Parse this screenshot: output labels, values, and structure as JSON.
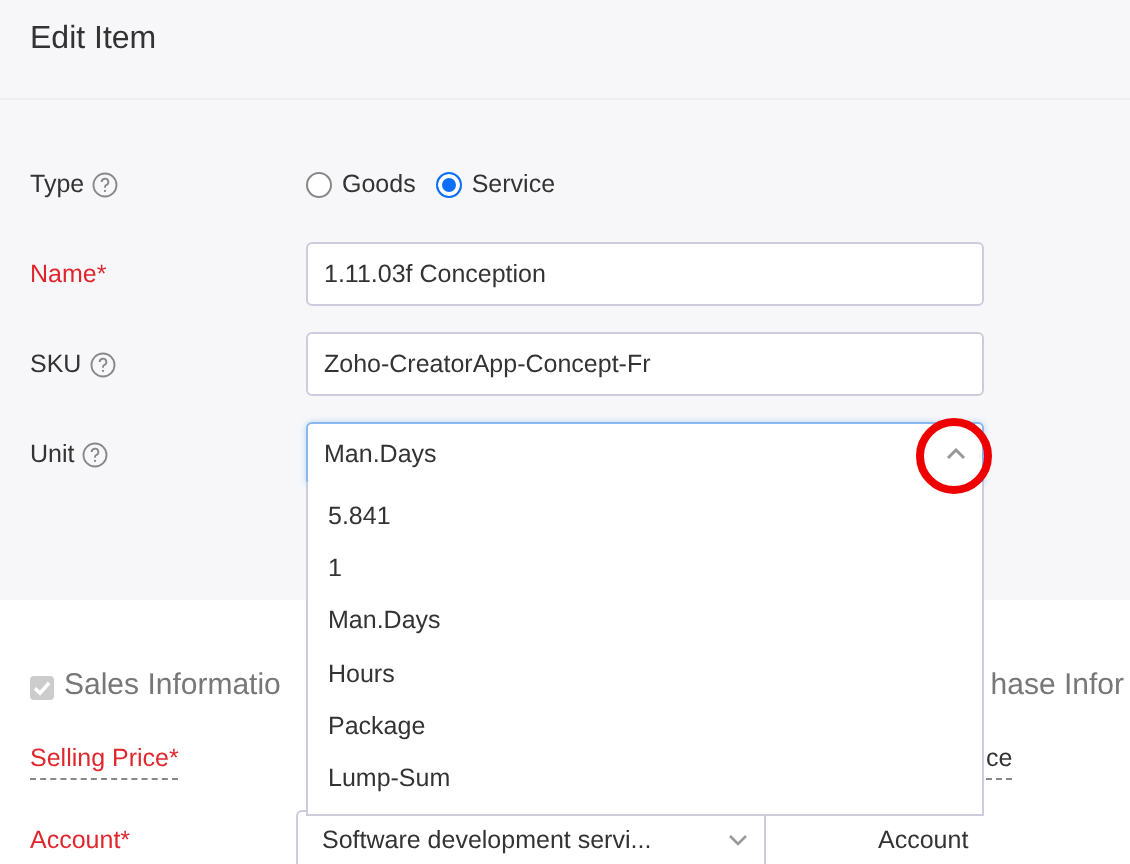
{
  "window": {
    "title": "Edit Item"
  },
  "type_field": {
    "label": "Type",
    "options": [
      {
        "label": "Goods",
        "selected": false
      },
      {
        "label": "Service",
        "selected": true
      }
    ]
  },
  "name_field": {
    "label": "Name*",
    "value": "1.11.03f Conception"
  },
  "sku_field": {
    "label": "SKU",
    "value": "Zoho-CreatorApp-Concept-Fr"
  },
  "unit_field": {
    "label": "Unit",
    "value": "Man.Days",
    "expanded": true,
    "options": [
      "5.841",
      "1",
      "Man.Days",
      "Hours",
      "Package",
      "Lump-Sum"
    ]
  },
  "sales_section": {
    "title": "Sales Informatio",
    "checked": true
  },
  "purchase_section": {
    "title": "hase Infor"
  },
  "selling_price": {
    "label": "Selling Price*"
  },
  "purchase_price": {
    "label": "ce"
  },
  "account": {
    "label": "Account*",
    "value": "Software development servi..."
  },
  "purchase_account": {
    "label": "Account"
  }
}
